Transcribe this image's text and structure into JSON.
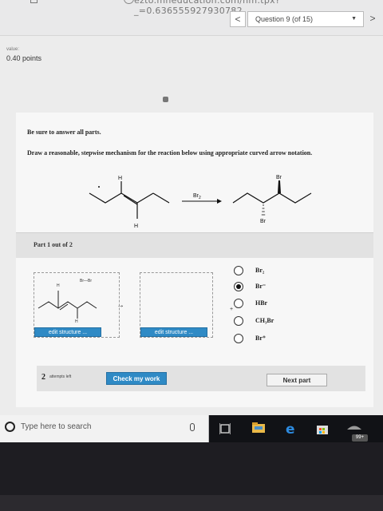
{
  "browser": {
    "url_fragment": "ezto.mheducation.com/hm.tpx?_=0.636555927930782"
  },
  "quiz_nav": {
    "prev": "<",
    "question_label": "Question 9 (of 15)",
    "next": ">"
  },
  "score": {
    "value_label": "value:",
    "points": "0.40 points"
  },
  "question": {
    "instruction1": "Be sure to answer all parts.",
    "instruction2": "Draw a reasonable, stepwise mechanism for the reaction below using appropriate curved arrow notation.",
    "reagent": "Br2",
    "reagent_sub": "2",
    "reagent_base": "Br",
    "h_label": "H",
    "br_label": "Br"
  },
  "part": {
    "label": "Part 1 out of 2"
  },
  "workspace": {
    "br_br": "Br—Br",
    "h_label": "H",
    "edit_button": "edit structure ...",
    "arrow": "→",
    "plus": "+"
  },
  "choices": [
    {
      "label": "Br₂",
      "selected": false
    },
    {
      "label": "Br⁻",
      "selected": true
    },
    {
      "label": "HBr",
      "selected": false
    },
    {
      "label": "CH₃Br",
      "selected": false
    },
    {
      "label": "Br⁺",
      "selected": false
    }
  ],
  "footer": {
    "attempts_num": "2",
    "attempts_label": "attempts left",
    "check_button": "Check my work",
    "next_button": "Next part"
  },
  "taskbar": {
    "search_placeholder": "Type here to search",
    "badge": "99+"
  }
}
